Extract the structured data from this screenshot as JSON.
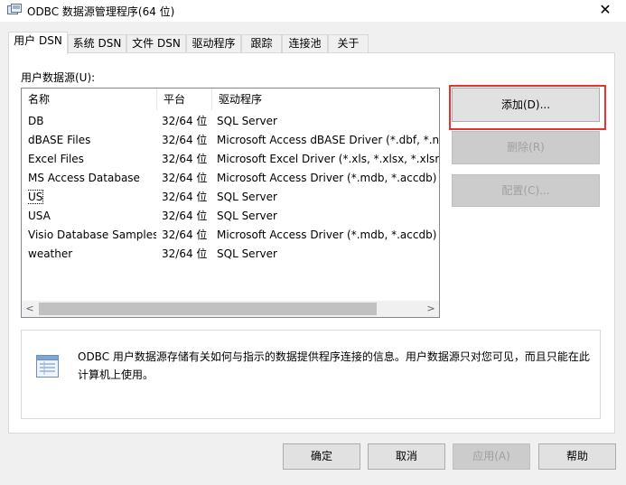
{
  "window": {
    "title": "ODBC 数据源管理程序(64 位)",
    "close_glyph": "✕"
  },
  "tabs": [
    {
      "label": "用户 DSN",
      "active": true
    },
    {
      "label": "系统 DSN",
      "active": false
    },
    {
      "label": "文件 DSN",
      "active": false
    },
    {
      "label": "驱动程序",
      "active": false
    },
    {
      "label": "跟踪",
      "active": false
    },
    {
      "label": "连接池",
      "active": false
    },
    {
      "label": "关于",
      "active": false
    }
  ],
  "user_dsn": {
    "caption": "用户数据源(U):",
    "columns": [
      "名称",
      "平台",
      "驱动程序"
    ],
    "rows": [
      {
        "name": "DB",
        "platform": "32/64 位",
        "driver": "SQL Server"
      },
      {
        "name": "dBASE Files",
        "platform": "32/64 位",
        "driver": "Microsoft Access dBASE Driver (*.dbf, *.nd"
      },
      {
        "name": "Excel Files",
        "platform": "32/64 位",
        "driver": "Microsoft Excel Driver (*.xls, *.xlsx, *.xlsm, *"
      },
      {
        "name": "MS Access Database",
        "platform": "32/64 位",
        "driver": "Microsoft Access Driver (*.mdb, *.accdb)"
      },
      {
        "name": "US",
        "platform": "32/64 位",
        "driver": "SQL Server"
      },
      {
        "name": "USA",
        "platform": "32/64 位",
        "driver": "SQL Server"
      },
      {
        "name": "Visio Database Samples",
        "platform": "32/64 位",
        "driver": "Microsoft Access Driver (*.mdb, *.accdb)"
      },
      {
        "name": "weather",
        "platform": "32/64 位",
        "driver": "SQL Server"
      }
    ],
    "scroll": {
      "left_glyph": "<",
      "right_glyph": ">"
    },
    "buttons": {
      "add": "添加(D)...",
      "remove": "删除(R)",
      "configure": "配置(C)..."
    },
    "info_text": "ODBC 用户数据源存储有关如何与指示的数据提供程序连接的信息。用户数据源只对您可见，而且只能在此计算机上使用。"
  },
  "footer": {
    "ok": "确定",
    "cancel": "取消",
    "apply": "应用(A)",
    "help": "帮助"
  },
  "colors": {
    "highlight_border": "#e8322d",
    "disabled_text": "#a0a0a0"
  }
}
